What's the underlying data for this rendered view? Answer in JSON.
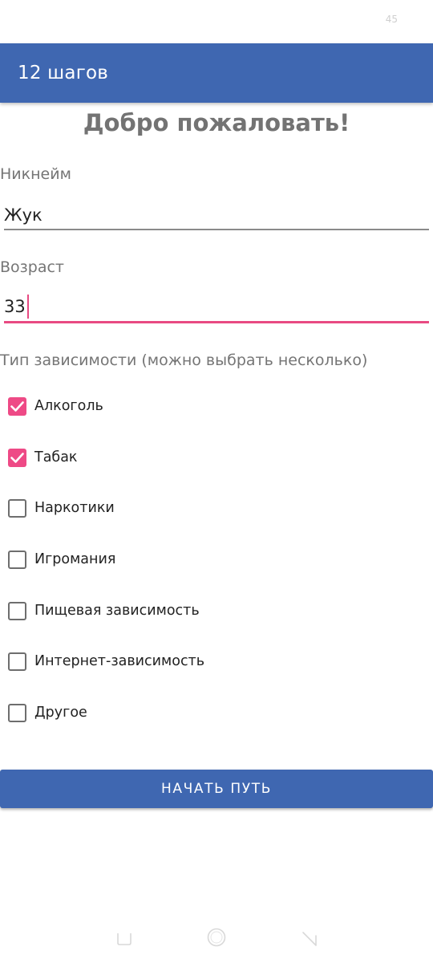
{
  "status_bar": {
    "battery_level": "45"
  },
  "app_bar": {
    "title": "12 шагов",
    "color": "#3f67b1"
  },
  "welcome": {
    "title": "Добро пожаловать!"
  },
  "form": {
    "nickname": {
      "label": "Никнейм",
      "value": "Жук"
    },
    "age": {
      "label": "Возраст",
      "value": "33",
      "focused": true
    },
    "addiction_type": {
      "label": "Тип зависимости (можно выбрать несколько)",
      "options": [
        {
          "label": "Алкоголь",
          "checked": true
        },
        {
          "label": "Табак",
          "checked": true
        },
        {
          "label": "Наркотики",
          "checked": false
        },
        {
          "label": "Игромания",
          "checked": false
        },
        {
          "label": "Пищевая зависимость",
          "checked": false
        },
        {
          "label": "Интернет-зависимость",
          "checked": false
        },
        {
          "label": "Другое",
          "checked": false
        }
      ]
    }
  },
  "actions": {
    "start_label": "НАЧАТЬ ПУТЬ"
  },
  "colors": {
    "primary": "#3f67b1",
    "accent": "#ee4a86",
    "label_gray": "#757575"
  },
  "nav_bar": {
    "icons": [
      "recents-icon",
      "home-icon",
      "back-icon"
    ]
  }
}
